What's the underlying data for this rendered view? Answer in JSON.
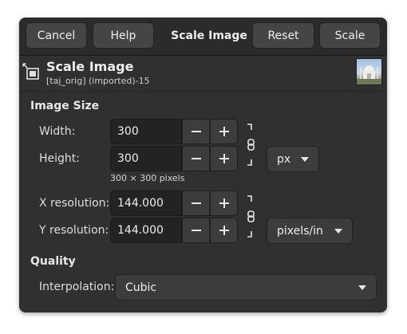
{
  "header": {
    "cancel_label": "Cancel",
    "help_label": "Help",
    "title": "Scale Image",
    "reset_label": "Reset",
    "scale_label": "Scale"
  },
  "page": {
    "title": "Scale Image",
    "subtitle": "[taj_orig] (imported)-15"
  },
  "image_size": {
    "section_label": "Image Size",
    "width_label": "Width:",
    "width_value": "300",
    "height_label": "Height:",
    "height_value": "300",
    "unit": "px",
    "pixel_info": "300 × 300 pixels",
    "xres_label": "X resolution:",
    "xres_value": "144.000",
    "yres_label": "Y resolution:",
    "yres_value": "144.000",
    "res_unit": "pixels/in"
  },
  "quality": {
    "section_label": "Quality",
    "interpolation_label": "Interpolation:",
    "interpolation_value": "Cubic"
  },
  "icons": {
    "minus": "minus-icon",
    "plus": "plus-icon",
    "chain": "chain-linked-icon",
    "dialog": "scale-image-icon",
    "dropdown": "chevron-down-icon"
  },
  "colors": {
    "dialog_bg": "#303030",
    "headerbar_bg": "#2b2b2b",
    "button_bg": "#454545",
    "field_bg": "#232323",
    "text": "#e6e6e6"
  }
}
